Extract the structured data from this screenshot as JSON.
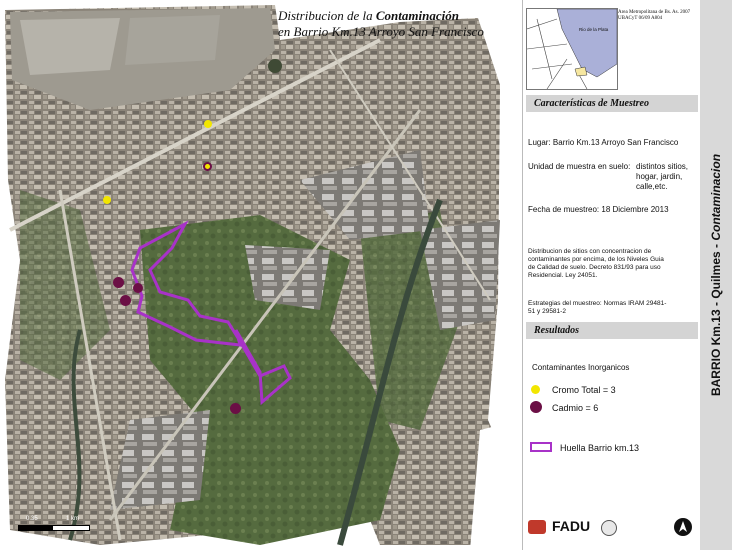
{
  "title": {
    "line1_pre": "Distribucion de la ",
    "line1_bold": "Contaminación",
    "line2": "en Barrio Km.13  Arroyo San Francisco"
  },
  "inset": {
    "label": "Rio de la Plata",
    "caption_line1": "Area Metropolitana de Bs. As. 2007",
    "caption_line2": "UBACyT 06/09   A804"
  },
  "panel": {
    "muestreo_header": "Características de Muestreo",
    "lugar": "Lugar:  Barrio Km.13  Arroyo San Francisco",
    "unidad_label": "Unidad de muestra en suelo:",
    "unidad_value": "distintos sitios, hogar, jardin, calle,etc.",
    "fecha": "Fecha de muestreo:  18 Diciembre 2013",
    "distribucion": "Distribucion de sitios con concentracion de contaminantes por encima, de los Niveles Guia de Calidad de suelo. Decreto 831/93 para uso Residencial. Ley 24051.",
    "estrategias": "Estrategias del muestreo: Normas IRAM  29481-51 y 29581-2",
    "resultados_header": "Resultados",
    "inorg": "Contaminantes Inorganicos",
    "cromo": "Cromo Total = 3",
    "cadmio": "Cadmio = 6",
    "huella": "Huella Barrio km.13",
    "fadu": "FADU"
  },
  "side_title": {
    "part1": "BARRIO Km.13 - Quilmes - ",
    "part2": "Contaminacion"
  },
  "scale_bar": {
    "left_label": "0.35",
    "right_label": "1 km"
  },
  "colors": {
    "cromo": "#f2e600",
    "cadmio": "#6b0f45",
    "huella": "#a832c8",
    "header_bg": "#d4d4d4",
    "strip_bg": "#d9d9d9"
  },
  "map_points": {
    "cromo": [
      {
        "name": "cromo-point-1"
      },
      {
        "name": "cromo-point-2"
      },
      {
        "name": "cromo-point-3"
      }
    ],
    "cadmio": [
      {
        "name": "cadmio-point-1"
      },
      {
        "name": "cadmio-point-2"
      },
      {
        "name": "cadmio-point-3"
      },
      {
        "name": "cadmio-point-4"
      },
      {
        "name": "cadmio-point-5"
      },
      {
        "name": "cadmio-point-6"
      }
    ]
  }
}
